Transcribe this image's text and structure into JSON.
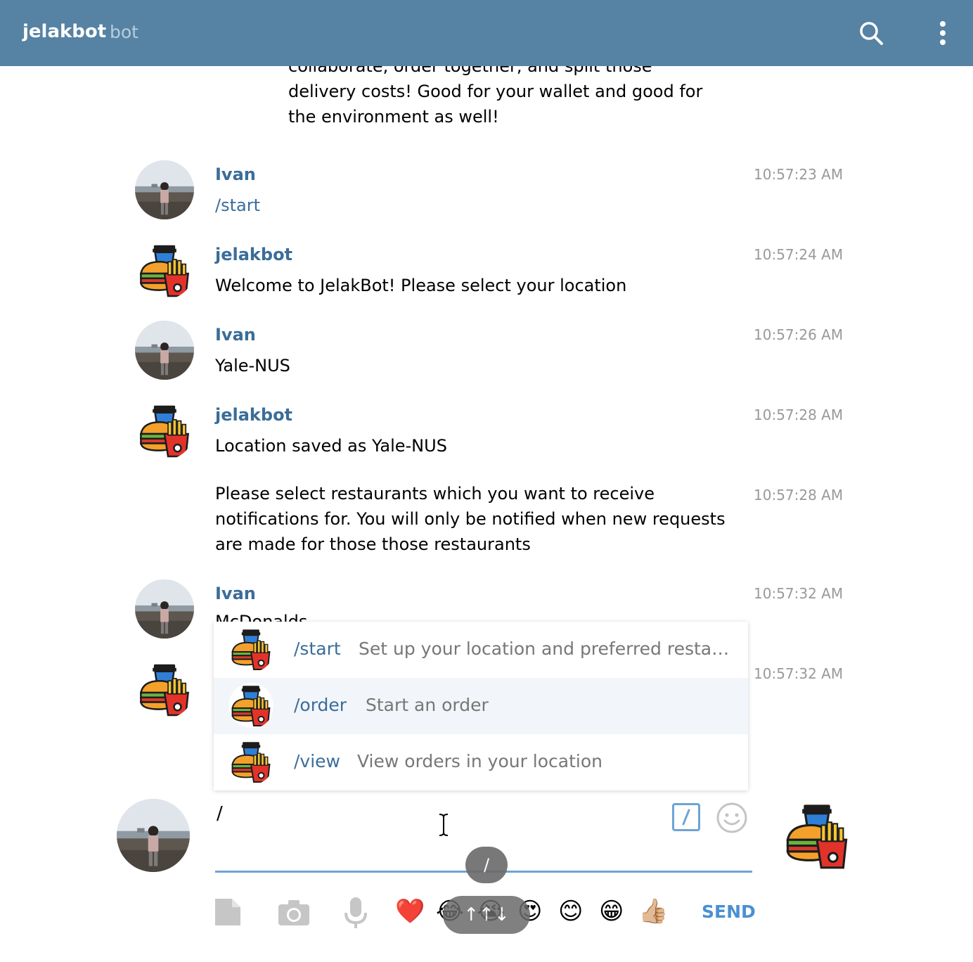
{
  "header": {
    "title": "jelakbot",
    "subtitle": "bot"
  },
  "intro_text": "collaborate, order together, and split those delivery costs! Good for your wallet and good for the environment as well!",
  "messages": [
    {
      "sender": "Ivan",
      "text": "/start",
      "time": "10:57:23 AM"
    },
    {
      "sender": "jelakbot",
      "text": "Welcome to JelakBot! Please select your location",
      "time": "10:57:24 AM"
    },
    {
      "sender": "Ivan",
      "text": "Yale-NUS",
      "time": "10:57:26 AM"
    },
    {
      "sender": "jelakbot",
      "text": "Location saved as Yale-NUS",
      "time": "10:57:28 AM"
    },
    {
      "sender": "",
      "text": "Please select restaurants which you want to receive notifications for. You will only be notified when new requests are made for those those restaurants",
      "time": "10:57:28 AM"
    },
    {
      "sender": "Ivan",
      "text": "McDonalds",
      "time": "10:57:32 AM"
    },
    {
      "sender": "",
      "text": "",
      "time": "10:57:32 AM"
    }
  ],
  "commands": [
    {
      "name": "/start",
      "desc": "Set up your location and preferred resta…"
    },
    {
      "name": "/order",
      "desc": "Start an order"
    },
    {
      "name": "/view",
      "desc": "View orders in your location"
    }
  ],
  "composer": {
    "input_value": "/",
    "send_label": "SEND",
    "hint_slash": "/",
    "hint_arrows": "↑↑↓"
  },
  "icons": {
    "search": "search-icon",
    "menu": "more-vert-icon",
    "file": "file-icon",
    "camera": "camera-icon",
    "mic": "microphone-icon",
    "slash": "slash-command-icon",
    "smile": "smiley-icon"
  },
  "emojis": [
    "❤️",
    "😂",
    "😭",
    "😍",
    "😊",
    "😁",
    "👍🏼"
  ],
  "colors": {
    "header": "#5682a3",
    "name": "#3a6d99",
    "accent": "#4a90d2"
  }
}
